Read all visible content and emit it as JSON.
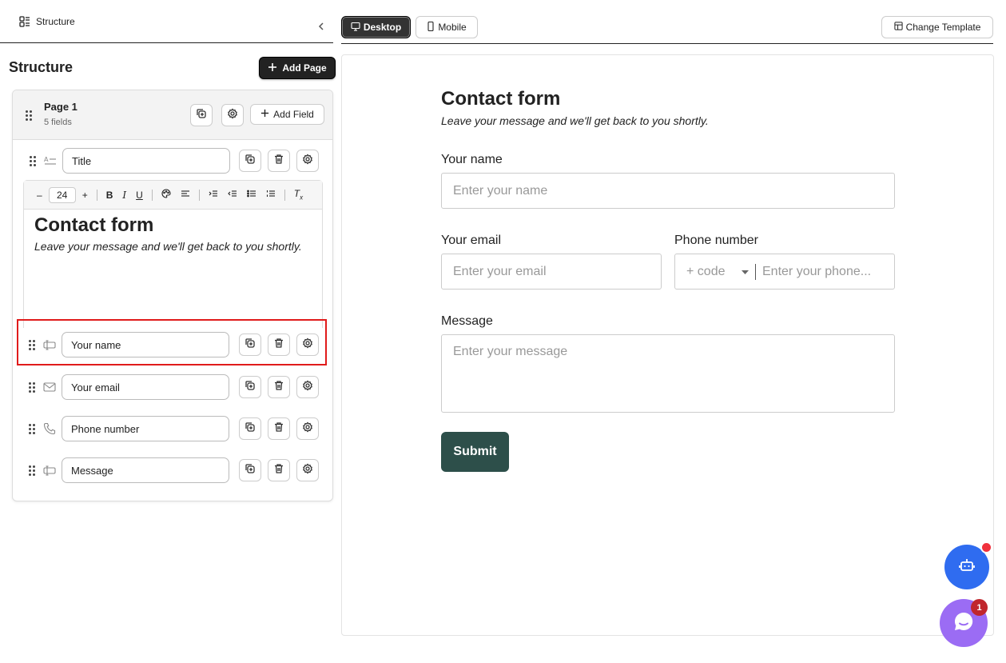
{
  "sidebar": {
    "tab_label": "Structure",
    "heading": "Structure",
    "add_page_label": "Add Page",
    "page": {
      "name": "Page 1",
      "field_count": "5 fields",
      "add_field_label": "Add Field"
    },
    "fields": [
      {
        "label": "Title",
        "icon": "heading-icon"
      },
      {
        "label": "Your name",
        "icon": "text-field-icon"
      },
      {
        "label": "Your email",
        "icon": "mail-icon"
      },
      {
        "label": "Phone number",
        "icon": "phone-icon"
      },
      {
        "label": "Message",
        "icon": "text-field-icon"
      }
    ],
    "editor": {
      "font_size": "24",
      "heading": "Contact form",
      "body": "Leave your message and we'll get back to you shortly."
    }
  },
  "topbar": {
    "desktop_label": "Desktop",
    "mobile_label": "Mobile",
    "change_template_label": "Change Template"
  },
  "preview": {
    "title": "Contact form",
    "subtitle": "Leave your message and we'll get back to you shortly.",
    "name_label": "Your name",
    "name_placeholder": "Enter your name",
    "email_label": "Your email",
    "email_placeholder": "Enter your email",
    "phone_label": "Phone number",
    "phone_code_placeholder": "+ code",
    "phone_placeholder": "Enter your phone...",
    "message_label": "Message",
    "message_placeholder": "Enter your message",
    "submit_label": "Submit"
  },
  "widgets": {
    "chat_badge": "1"
  },
  "colors": {
    "submit_bg": "#2d4f4a",
    "bot_button": "#2f6cf0",
    "chat_button": "#9b6cf4",
    "selection_outline": "#e01b1b"
  }
}
